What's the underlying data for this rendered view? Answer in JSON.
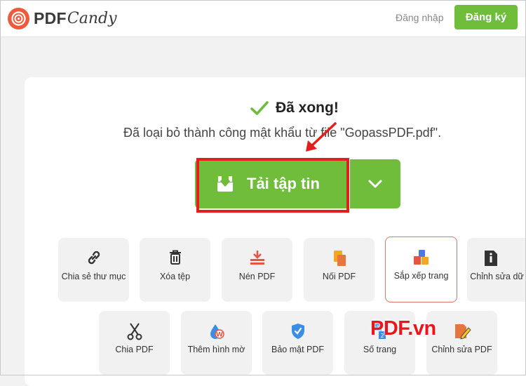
{
  "header": {
    "logo_text_a": "PDF",
    "logo_text_b": "Candy",
    "login_label": "Đăng nhập",
    "signup_label": "Đăng ký"
  },
  "status": {
    "title": "Đã xong!",
    "message": "Đã loại bỏ thành công mật khẩu từ file \"GopassPDF.pdf\"."
  },
  "download": {
    "label": "Tải tập tin"
  },
  "tools": [
    {
      "label": "Chia sẻ thư mục",
      "icon": "link-icon"
    },
    {
      "label": "Xóa tệp",
      "icon": "trash-icon"
    },
    {
      "label": "Nén PDF",
      "icon": "compress-icon"
    },
    {
      "label": "Nối PDF",
      "icon": "merge-icon"
    },
    {
      "label": "Sắp xếp trang",
      "icon": "arrange-pages-icon"
    },
    {
      "label": "Chỉnh sửa dữ liệu",
      "icon": "info-doc-icon"
    },
    {
      "label": "Chia PDF",
      "icon": "scissors-icon"
    },
    {
      "label": "Thêm hình mờ",
      "icon": "watermark-icon"
    },
    {
      "label": "Bảo mật PDF",
      "icon": "shield-icon"
    },
    {
      "label": "Số trang",
      "icon": "page-number-icon"
    },
    {
      "label": "Chỉnh sửa PDF",
      "icon": "edit-pdf-icon"
    }
  ],
  "watermark": {
    "text": "PDF.vn"
  },
  "colors": {
    "brand_green": "#6fbd3b",
    "logo_orange": "#ef5a3b",
    "highlight_red": "#e41d1d"
  }
}
